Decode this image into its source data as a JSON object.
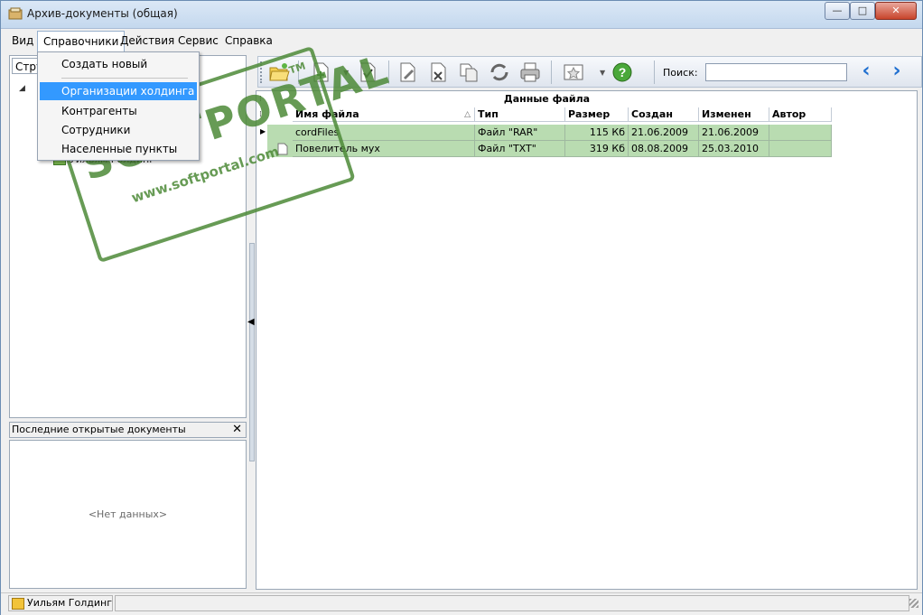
{
  "window": {
    "title": "Архив-документы (общая)",
    "controls": {
      "minimize": "—",
      "maximize": "□",
      "close": "✕"
    }
  },
  "menubar": {
    "items": [
      "Вид",
      "Справочники",
      "Действия",
      "Сервис",
      "Справка"
    ],
    "active_index": 1
  },
  "dropdown": {
    "items": [
      "Создать новый",
      "Организации холдинга",
      "Контрагенты",
      "Сотрудники",
      "Населенные пункты"
    ],
    "highlighted": "Организации холдинга"
  },
  "left_panel": {
    "combo_value": "Стру",
    "tree_node": "Уильям Голдинг",
    "recent_title": "Последние открытые документы",
    "recent_empty": "<Нет данных>"
  },
  "toolbar": {
    "search_label": "Поиск:",
    "search_value": "",
    "icons": [
      "open-folder-icon",
      "new-document-icon",
      "check-document-icon",
      "edit-document-icon",
      "delete-document-icon",
      "copy-document-icon",
      "refresh-icon",
      "print-icon",
      "favorites-icon",
      "help-icon"
    ]
  },
  "grid": {
    "group_header": "Данные файла",
    "columns": [
      "Имя файла",
      "Тип",
      "Размер",
      "Создан",
      "Изменен",
      "Автор"
    ],
    "rows": [
      {
        "name": "cordFiles",
        "type": "Файл \"RAR\"",
        "size": "115 Кб",
        "created": "21.06.2009",
        "modified": "21.06.2009",
        "author": ""
      },
      {
        "name": "Повелитель мух",
        "type": "Файл \"TXT\"",
        "size": "319 Кб",
        "created": "08.08.2009",
        "modified": "25.03.2010",
        "author": ""
      }
    ]
  },
  "watermark": {
    "logo": "SOFTPORTAL",
    "tm": "TM",
    "url": "www.softportal.com"
  },
  "statusbar": {
    "user": "Уильям Голдинг"
  },
  "colors": {
    "row_bg": "#b9dcb1",
    "highlight": "#3399ff",
    "watermark": "#4d8a38"
  }
}
